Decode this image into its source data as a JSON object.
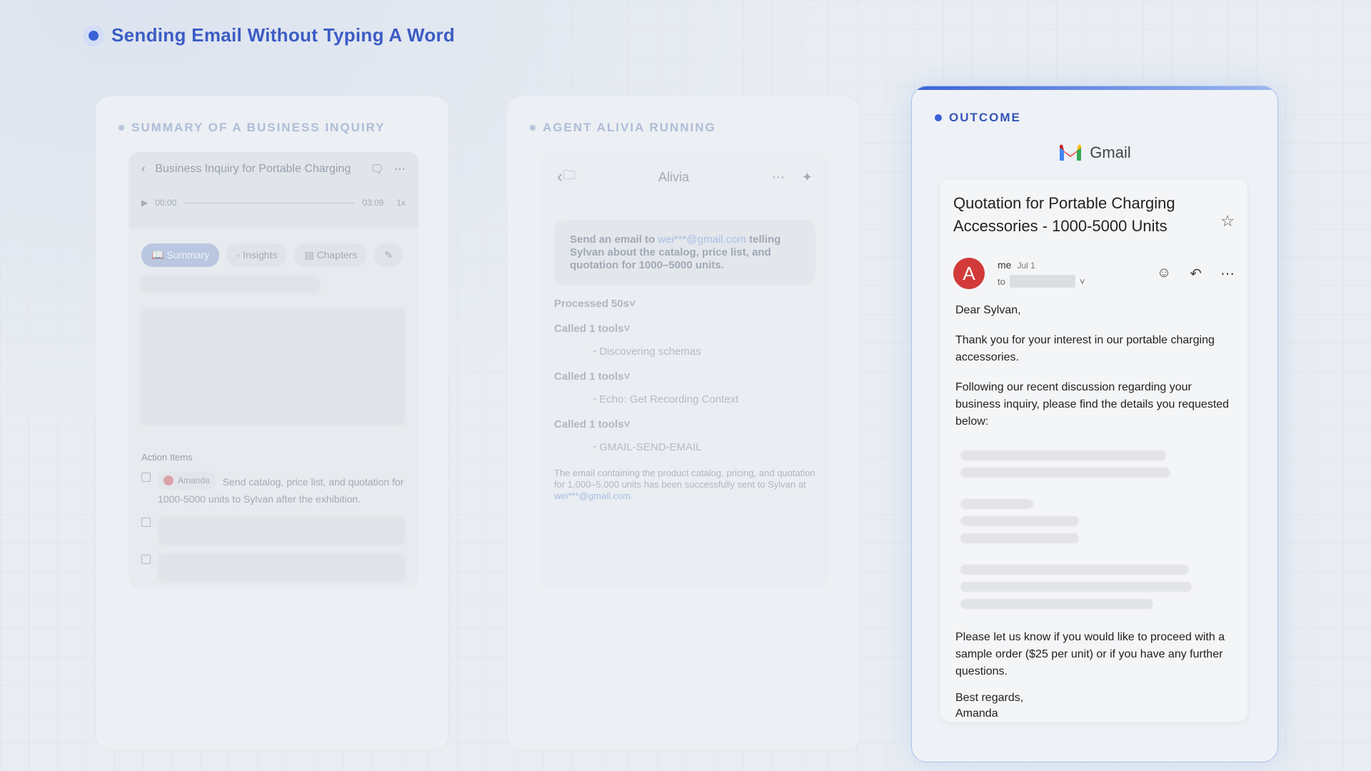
{
  "page_title": "Sending Email Without Typing A Word",
  "panels": {
    "summary": {
      "label": "SUMMARY OF A BUSINESS INQUIRY",
      "recording_title": "Business Inquiry for Portable Charging",
      "time_start": "00:00",
      "time_end": "03:09",
      "speed": "1x",
      "tabs": [
        "Summary",
        "Insights",
        "Chapters"
      ],
      "action_items_label": "Action Items",
      "assignee": "Amanda",
      "action_item_text": "Send catalog, price list, and quotation for 1000-5000 units to Sylvan after the exhibition."
    },
    "agent": {
      "label": "AGENT ALIVIA RUNNING",
      "header_title": "Alivia",
      "prompt_prefix": "Send an email to",
      "prompt_email": "wei***@gmail.com",
      "prompt_rest": "telling Sylvan about the catalog, price list, and quotation for 1000–5000 units.",
      "processed": "Processed 50s",
      "steps": [
        {
          "label": "Called 1 tools",
          "tool": "Discovering schemas"
        },
        {
          "label": "Called 1 tools",
          "tool": "Echo: Get Recording Context"
        },
        {
          "label": "Called 1 tools",
          "tool": "GMAIL-SEND-EMAIL"
        }
      ],
      "result_text": "The email containing the product catalog, pricing, and quotation for 1,000–5,000 units has been successfully sent to Sylvan at",
      "result_email": "wei***@gmail.com."
    },
    "outcome": {
      "label": "OUTCOME",
      "brand": "Gmail",
      "subject": "Quotation for Portable Charging Accessories - 1000-5000 Units",
      "sender": "me",
      "date": "Jul 1",
      "to_label": "to",
      "avatar_letter": "A",
      "greeting": "Dear Sylvan,",
      "para1": "Thank you for your interest in our portable charging accessories.",
      "para2": "Following our recent discussion regarding your business inquiry, please find the details you requested below:",
      "para3": "Please let us know if you would like to proceed with a sample order ($25 per unit) or if you have any further questions.",
      "signoff": "Best regards,",
      "signature": "Amanda"
    }
  },
  "colors": {
    "accent": "#3a63d6",
    "avatar": "#d23a3a"
  }
}
